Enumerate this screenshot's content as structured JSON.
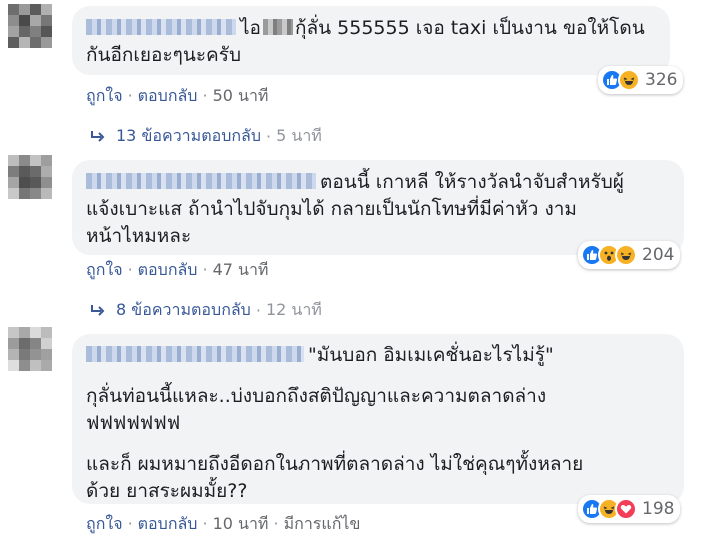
{
  "comments": [
    {
      "text_lines": [
        "ไอ",
        "กุ้ลั่น 555555 เจอ taxi เป็นงาน ขอให้โดน",
        "กันอีกเยอะๆนะครับ"
      ],
      "reactions": [
        "like",
        "haha"
      ],
      "reaction_count": "326",
      "actions": {
        "like": "ถูกใจ",
        "reply": "ตอบกลับ",
        "time": "50 นาที"
      },
      "replies": {
        "label": "13 ข้อความตอบกลับ",
        "time": "5 นาที"
      }
    },
    {
      "text_lines": [
        "ตอนนี้ เกาหลี ให้รางวัลนำจับสำหรับผู้",
        "แจ้งเบาะแส ถ้านำไปจับกุมได้ กลายเป็นนักโทษที่มีค่าหัว งาม",
        "หน้าไหมหละ"
      ],
      "reactions": [
        "like",
        "wow",
        "haha"
      ],
      "reaction_count": "204",
      "actions": {
        "like": "ถูกใจ",
        "reply": "ตอบกลับ",
        "time": "47 นาที"
      },
      "replies": {
        "label": "8 ข้อความตอบกลับ",
        "time": "12 นาที"
      }
    },
    {
      "text_lines": [
        "\"มันบอก อิมเมเคชั่นอะไรไม่รู้\"",
        "กุลั่นท่อนนี้แหละ..บ่งบอกถึงสติปัญญาและความตลาดล่าง",
        "ฟฟฟฟฟฟฟ",
        "และก็ ผมหมายถึงอีดอกในภาพที่ตลาดล่าง ไม่ใช่คุณๆทั้งหลาย",
        "ด้วย ยาสระผมมั้ย??"
      ],
      "reactions": [
        "like",
        "haha",
        "love"
      ],
      "reaction_count": "198",
      "actions": {
        "like": "ถูกใจ",
        "reply": "ตอบกลับ",
        "time": "10 นาที",
        "edited": "มีการแก้ไข"
      }
    }
  ],
  "colors": {
    "like": "#1877f2",
    "haha": "#f7b125",
    "love": "#f33e58",
    "link": "#385898",
    "meta": "#90949c",
    "bubble": "#f2f3f5"
  }
}
